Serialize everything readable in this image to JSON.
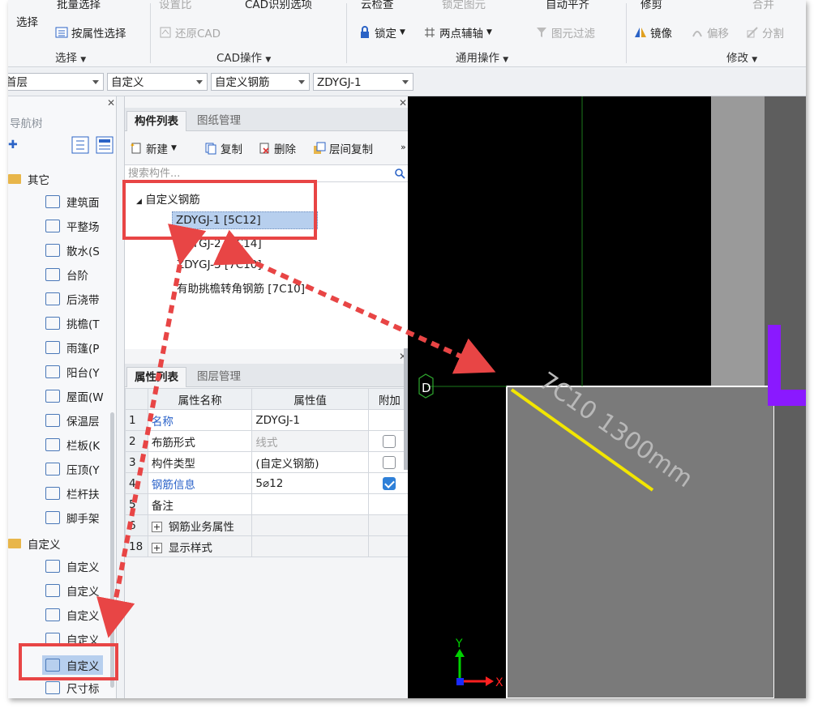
{
  "ribbon": {
    "partial_top": [
      "批量选择",
      "设置比",
      "CAD识别选项",
      "云检查",
      "锁定图元",
      "自动平齐",
      "修剪",
      "合并"
    ],
    "select_label": "选择",
    "select_by_prop": "按属性选择",
    "restore_cad": "还原CAD",
    "lock": "锁定",
    "two_point_axis": "两点辅轴",
    "filter": "图元过滤",
    "mirror": "镜像",
    "offset": "偏移",
    "split": "分割",
    "groups": [
      "选择",
      "CAD操作",
      "通用操作",
      "修改"
    ]
  },
  "selectors": [
    {
      "value": "首层"
    },
    {
      "value": "自定义"
    },
    {
      "value": "自定义钢筋"
    },
    {
      "value": "ZDYGJ-1"
    }
  ],
  "nav": {
    "title": "导航树",
    "group1": "其它",
    "items1": [
      "建筑面",
      "平整场",
      "散水(S",
      "台阶",
      "后浇带",
      "挑檐(T",
      "雨篷(P",
      "阳台(Y",
      "屋面(W",
      "保温层",
      "栏板(K",
      "压顶(Y",
      "栏杆扶",
      "脚手架"
    ],
    "group2": "自定义",
    "items2": [
      "自定义",
      "自定义",
      "自定义",
      "自定义",
      "自定义",
      "尺寸标"
    ]
  },
  "components": {
    "tabs": [
      "构件列表",
      "图纸管理"
    ],
    "toolbar": [
      "新建",
      "复制",
      "删除",
      "层间复制"
    ],
    "search_placeholder": "搜索构件...",
    "root": "自定义钢筋",
    "items": [
      "ZDYGJ-1 [5C12]",
      "ZDYGJ-2 [5C14]",
      "ZDYGJ-3 [7C10]",
      "有助挑檐转角钢筋 [7C10]"
    ]
  },
  "properties": {
    "tabs": [
      "属性列表",
      "图层管理"
    ],
    "headers": [
      "属性名称",
      "属性值",
      "附加"
    ],
    "rows": [
      {
        "num": "1",
        "name": "名称",
        "value": "ZDYGJ-1"
      },
      {
        "num": "2",
        "name": "布筋形式",
        "value": "线式"
      },
      {
        "num": "3",
        "name": "构件类型",
        "value": "(自定义钢筋)"
      },
      {
        "num": "4",
        "name": "钢筋信息",
        "value": "5⌀12"
      },
      {
        "num": "5",
        "name": "备注",
        "value": ""
      },
      {
        "num": "6",
        "name": "钢筋业务属性",
        "value": ""
      },
      {
        "num": "18",
        "name": "显示样式",
        "value": ""
      }
    ]
  },
  "canvas": {
    "axis_label": "D",
    "rebar_label": "7C10 1300mm",
    "axis_x": "X",
    "axis_y": "Y"
  },
  "colors": {
    "annotation_red": "#e84545",
    "rebar_yellow": "#f2e600",
    "purple": "#8a19ff",
    "select_blue": "#b7cfee"
  }
}
